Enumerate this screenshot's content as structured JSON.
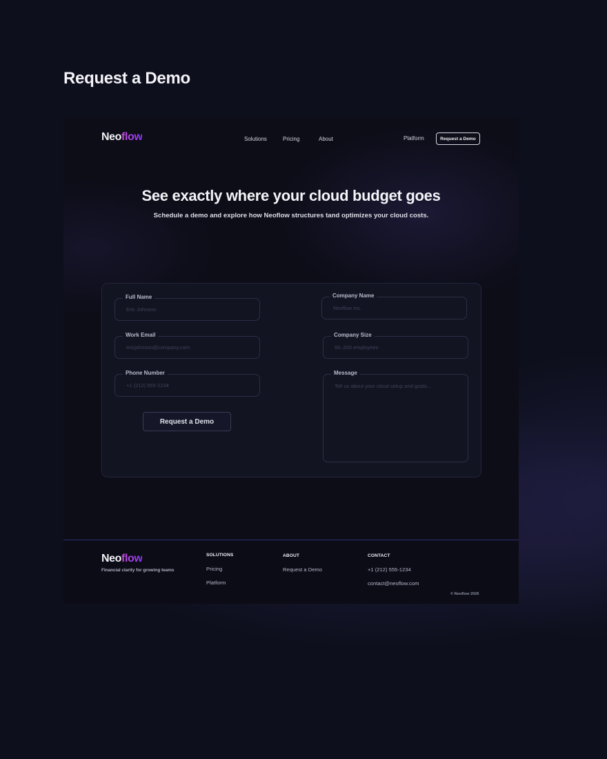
{
  "page": {
    "heading": "Request a Demo"
  },
  "colors": {
    "background": "#0d0f1c",
    "frame_background": "#0c0d17",
    "card_background": "#131422",
    "logo_gradient_start": "#c04cd0",
    "logo_gradient_end": "#8f36ff",
    "footer_divider": "#2e3170"
  },
  "nav": {
    "logo_part1": "Neo",
    "logo_part2": "flow",
    "links": [
      {
        "label": "Solutions"
      },
      {
        "label": "Pricing"
      },
      {
        "label": "About"
      }
    ],
    "platform_label": "Platform",
    "cta_label": "Request a Demo"
  },
  "hero": {
    "title": "See exactly where your cloud budget goes",
    "subtitle": "Schedule a demo and explore how Neoflow structures tand optimizes your cloud costs."
  },
  "form": {
    "full_name": {
      "label": "Full Name",
      "placeholder": "Eric Johnson",
      "value": ""
    },
    "work_email": {
      "label": "Work Email",
      "placeholder": "ericjohnson@company.com",
      "value": ""
    },
    "phone": {
      "label": "Phone Number",
      "placeholder": "+1 (212) 555-1234",
      "value": ""
    },
    "company_name": {
      "label": "Company Name",
      "placeholder": "Neoflow Inc.",
      "value": ""
    },
    "company_size": {
      "label": "Company Size",
      "placeholder": "50–200 employees",
      "value": ""
    },
    "message": {
      "label": "Message",
      "placeholder": "Tell us about your cloud setup and goals...",
      "value": ""
    },
    "submit_label": "Request a Demo"
  },
  "footer": {
    "logo_part1": "Neo",
    "logo_part2": "flow",
    "tagline": "Financial clarity for growing teams",
    "columns": [
      {
        "heading": "SOLUTIONS",
        "links": [
          "Pricing",
          "Platform"
        ]
      },
      {
        "heading": "ABOUT",
        "links": [
          "Request a Demo"
        ]
      },
      {
        "heading": "CONTACT",
        "links": [
          "+1 (212) 555-1234",
          "contact@neoflow.com"
        ]
      }
    ],
    "copyright": "© Neoflow 2026"
  }
}
